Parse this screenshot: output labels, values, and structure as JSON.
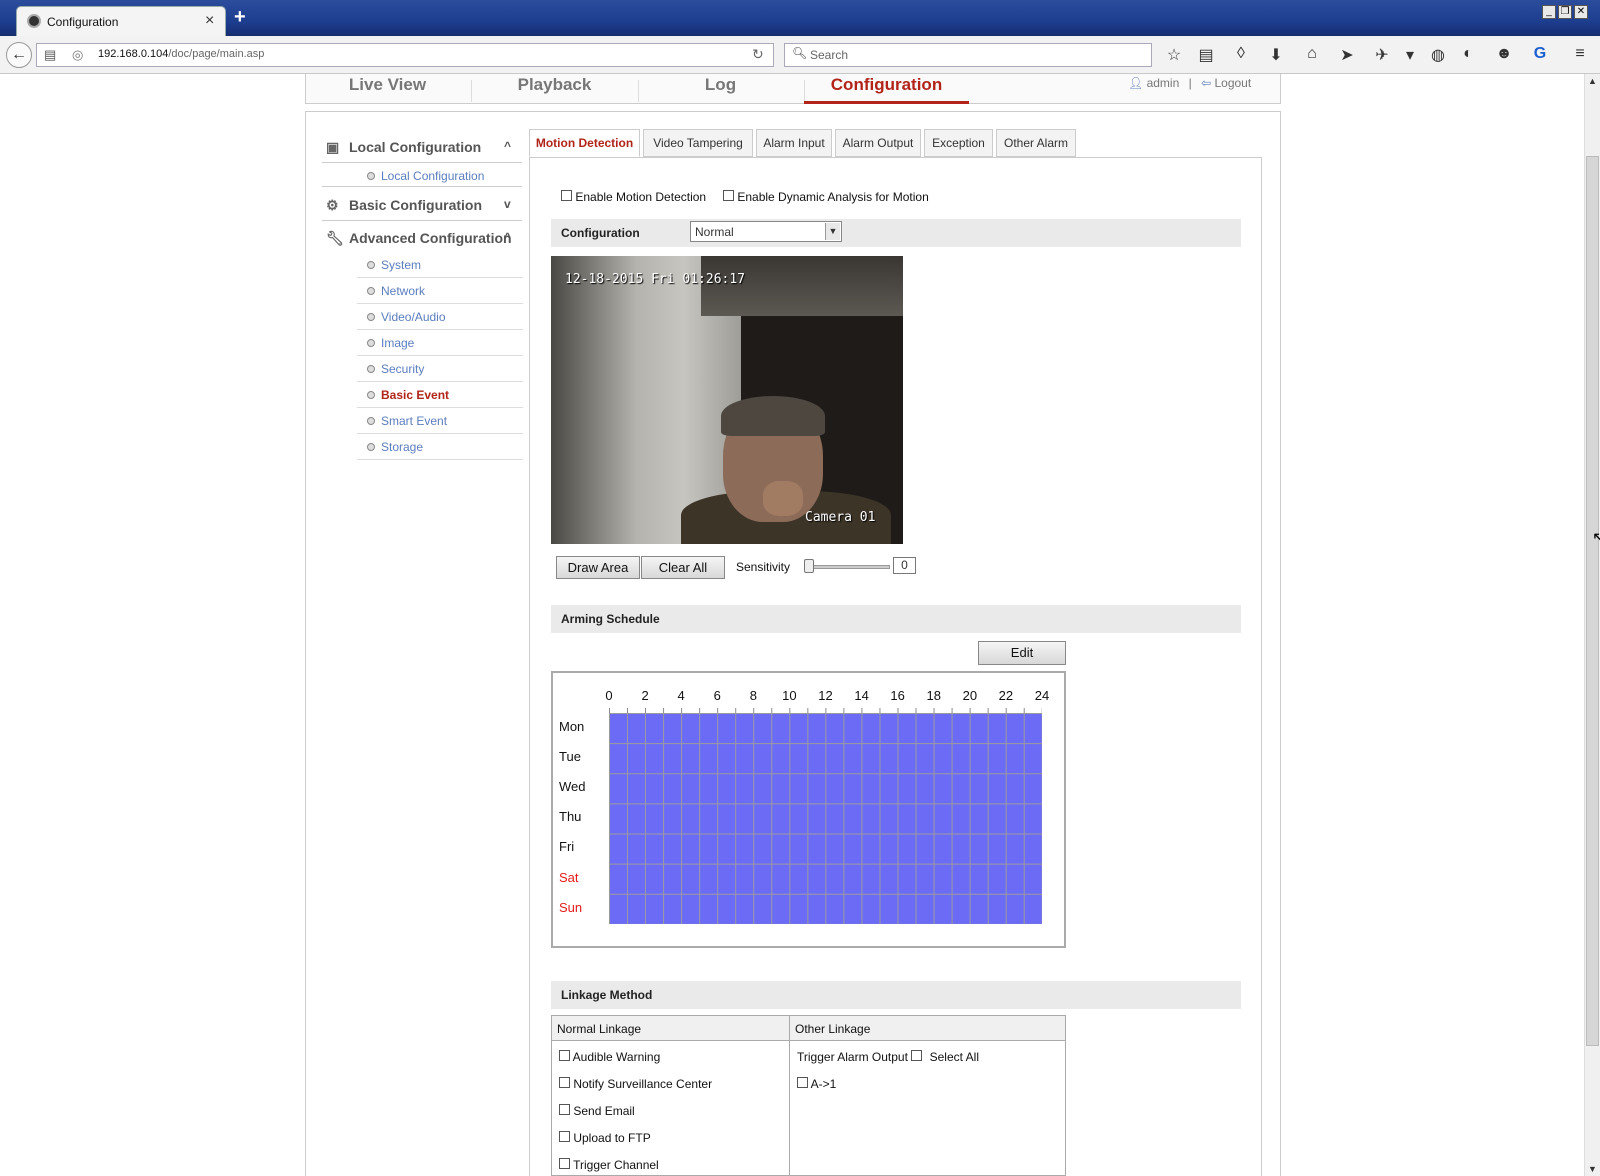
{
  "browser": {
    "tab_title": "Configuration",
    "new_tab": "+",
    "url_host": "192.168.0.104",
    "url_path": "/doc/page/main.asp",
    "search_placeholder": "Search",
    "window_controls": [
      "_",
      "❐",
      "✕"
    ]
  },
  "topnav": {
    "tabs": [
      "Live View",
      "Playback",
      "Log",
      "Configuration"
    ],
    "active": "Configuration",
    "user": "admin",
    "separator": "|",
    "logout": "Logout"
  },
  "sidebar": {
    "groups": [
      {
        "label": "Local Configuration",
        "caret": "^",
        "items": [
          "Local Configuration"
        ]
      },
      {
        "label": "Basic Configuration",
        "caret": "v",
        "items": []
      },
      {
        "label": "Advanced Configuration",
        "caret": "^",
        "items": [
          "System",
          "Network",
          "Video/Audio",
          "Image",
          "Security",
          "Basic Event",
          "Smart Event",
          "Storage"
        ]
      }
    ],
    "active_item": "Basic Event"
  },
  "content_tabs": [
    "Motion Detection",
    "Video Tampering",
    "Alarm Input",
    "Alarm Output",
    "Exception",
    "Other Alarm"
  ],
  "active_tab": "Motion Detection",
  "motion": {
    "enable_motion": "Enable Motion Detection",
    "enable_dynamic": "Enable Dynamic Analysis for Motion",
    "config_label": "Configuration",
    "config_value": "Normal",
    "osd_time": "12-18-2015 Fri 01:26:17",
    "osd_camera": "Camera 01",
    "draw_area": "Draw Area",
    "clear_all": "Clear All",
    "sensitivity_label": "Sensitivity",
    "sensitivity_value": "0"
  },
  "schedule": {
    "title": "Arming Schedule",
    "edit": "Edit",
    "hours": [
      "0",
      "2",
      "4",
      "6",
      "8",
      "10",
      "12",
      "14",
      "16",
      "18",
      "20",
      "22",
      "24"
    ],
    "days": [
      "Mon",
      "Tue",
      "Wed",
      "Thu",
      "Fri",
      "Sat",
      "Sun"
    ],
    "fill_color": "#6b6bf6",
    "weekend_color": "#e51c1c"
  },
  "linkage": {
    "title": "Linkage Method",
    "normal_header": "Normal Linkage",
    "other_header": "Other Linkage",
    "normal_items": [
      "Audible Warning",
      "Notify Surveillance Center",
      "Send Email",
      "Upload to FTP",
      "Trigger Channel"
    ],
    "trigger_alarm_output": "Trigger Alarm Output",
    "select_all": "Select All",
    "alarm_outputs": [
      "A->1"
    ]
  },
  "accent_color": "#b2241a"
}
